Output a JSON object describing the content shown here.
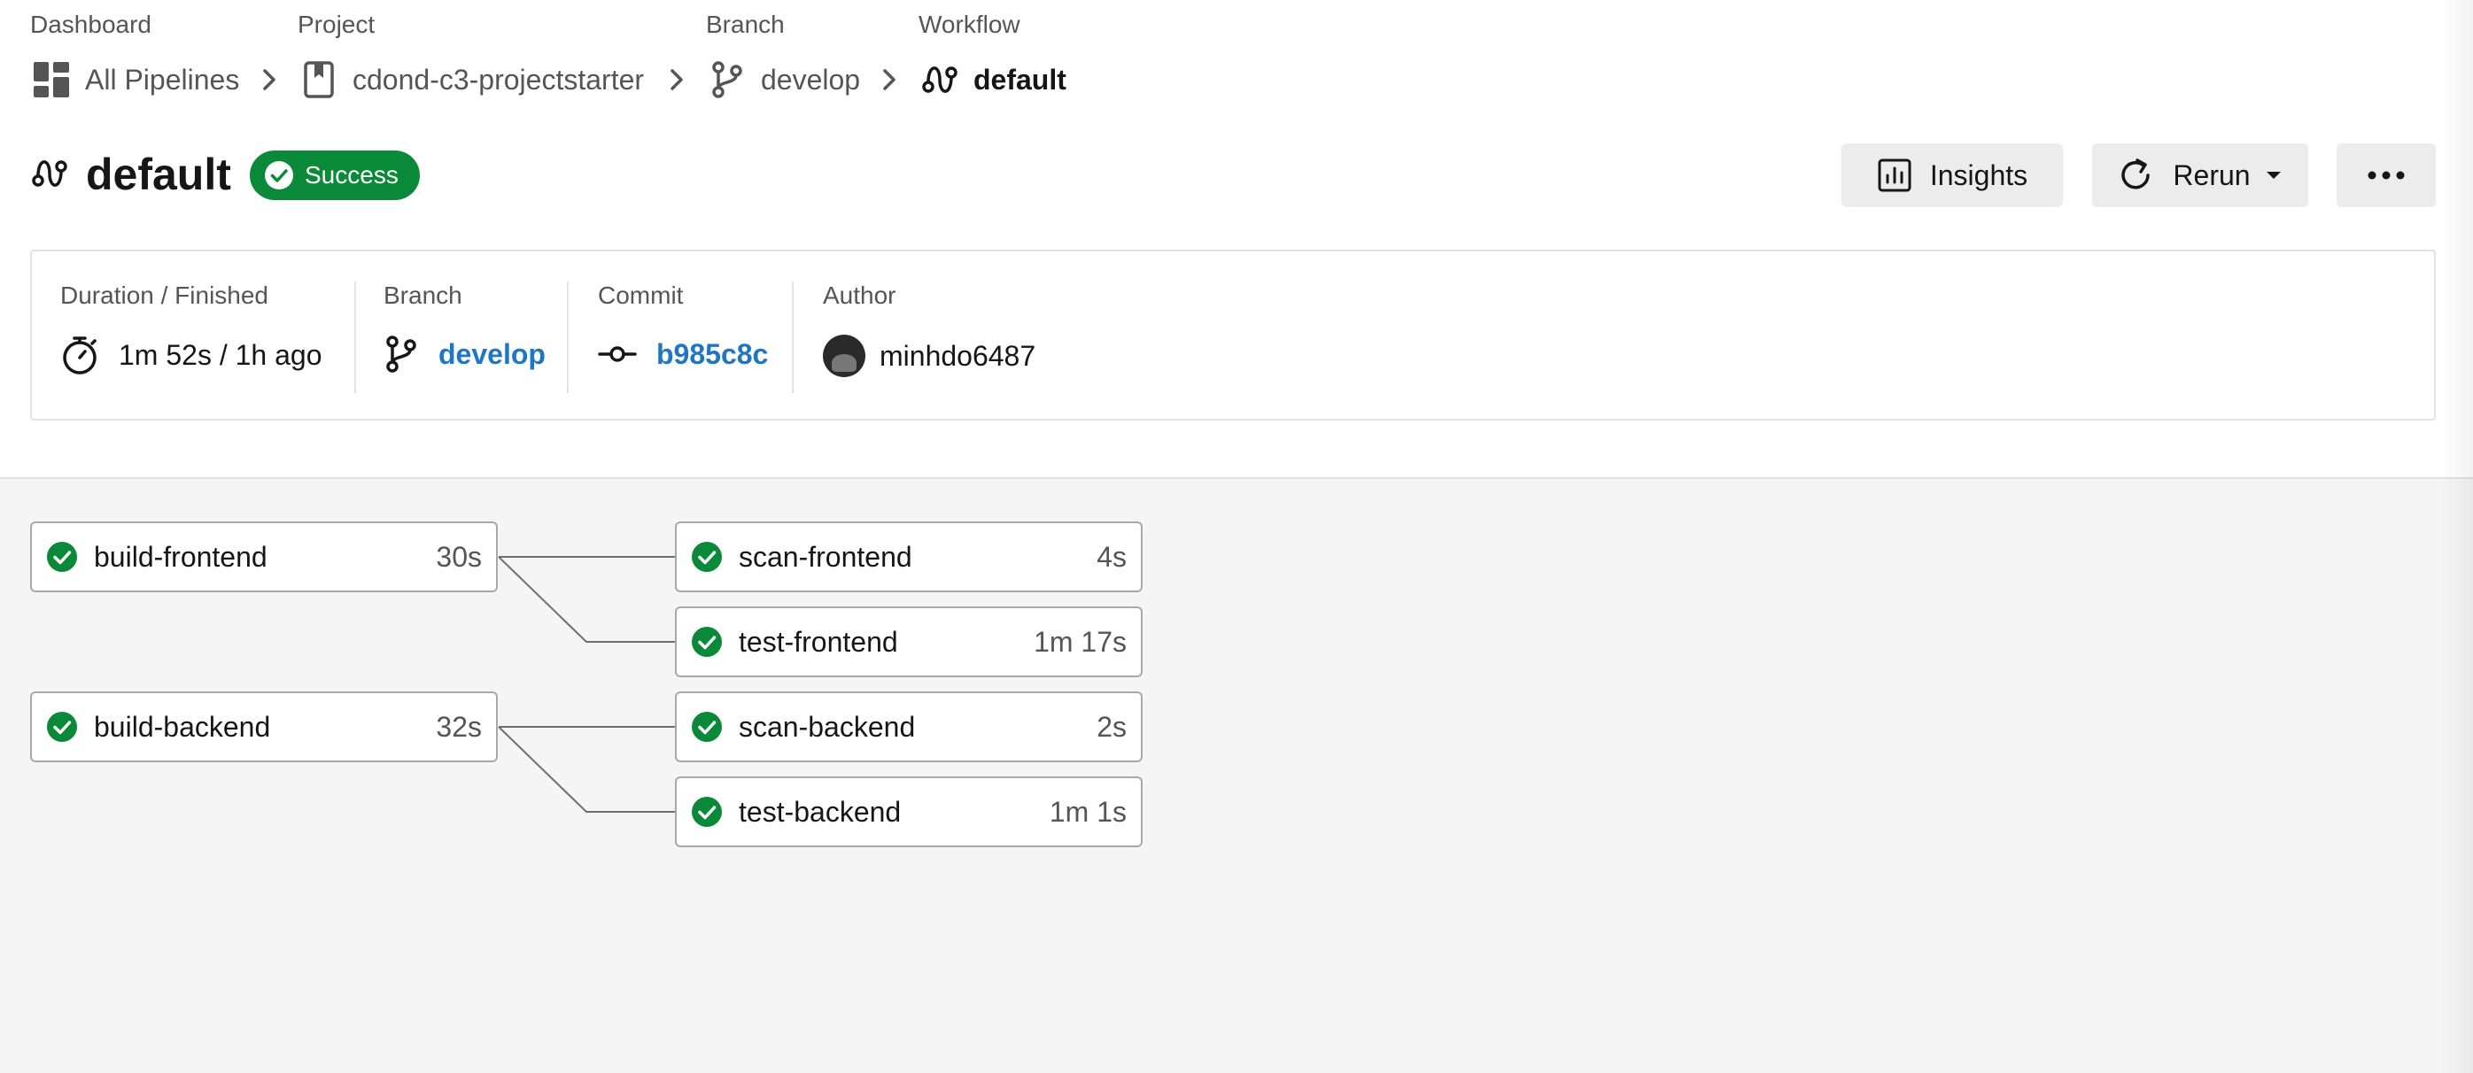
{
  "breadcrumb": {
    "dashboard": {
      "label": "Dashboard",
      "value": "All Pipelines"
    },
    "project": {
      "label": "Project",
      "value": "cdond-c3-projectstarter"
    },
    "branch": {
      "label": "Branch",
      "value": "develop"
    },
    "workflow": {
      "label": "Workflow",
      "value": "default"
    }
  },
  "header": {
    "title": "default",
    "status": "Success",
    "insights_label": "Insights",
    "rerun_label": "Rerun"
  },
  "info": {
    "duration": {
      "label": "Duration / Finished",
      "value": "1m 52s / 1h ago"
    },
    "branch": {
      "label": "Branch",
      "value": "develop"
    },
    "commit": {
      "label": "Commit",
      "value": "b985c8c"
    },
    "author": {
      "label": "Author",
      "value": "minhdo6487"
    }
  },
  "jobs": [
    {
      "name": "build-frontend",
      "duration": "30s",
      "status": "success"
    },
    {
      "name": "scan-frontend",
      "duration": "4s",
      "status": "success"
    },
    {
      "name": "test-frontend",
      "duration": "1m 17s",
      "status": "success"
    },
    {
      "name": "build-backend",
      "duration": "32s",
      "status": "success"
    },
    {
      "name": "scan-backend",
      "duration": "2s",
      "status": "success"
    },
    {
      "name": "test-backend",
      "duration": "1m 1s",
      "status": "success"
    }
  ],
  "colors": {
    "success": "#0a8a38",
    "link": "#1f76c2",
    "text": "#161616",
    "muted": "#555555"
  },
  "icons": {
    "dashboard": "grid-icon",
    "project": "bookmark-icon",
    "branch": "git-branch-icon",
    "workflow": "workflow-icon",
    "duration": "stopwatch-icon",
    "commit": "git-commit-icon",
    "insights": "bar-chart-icon",
    "rerun": "refresh-icon",
    "more": "more-horizontal-icon",
    "status": "check-circle-icon"
  }
}
